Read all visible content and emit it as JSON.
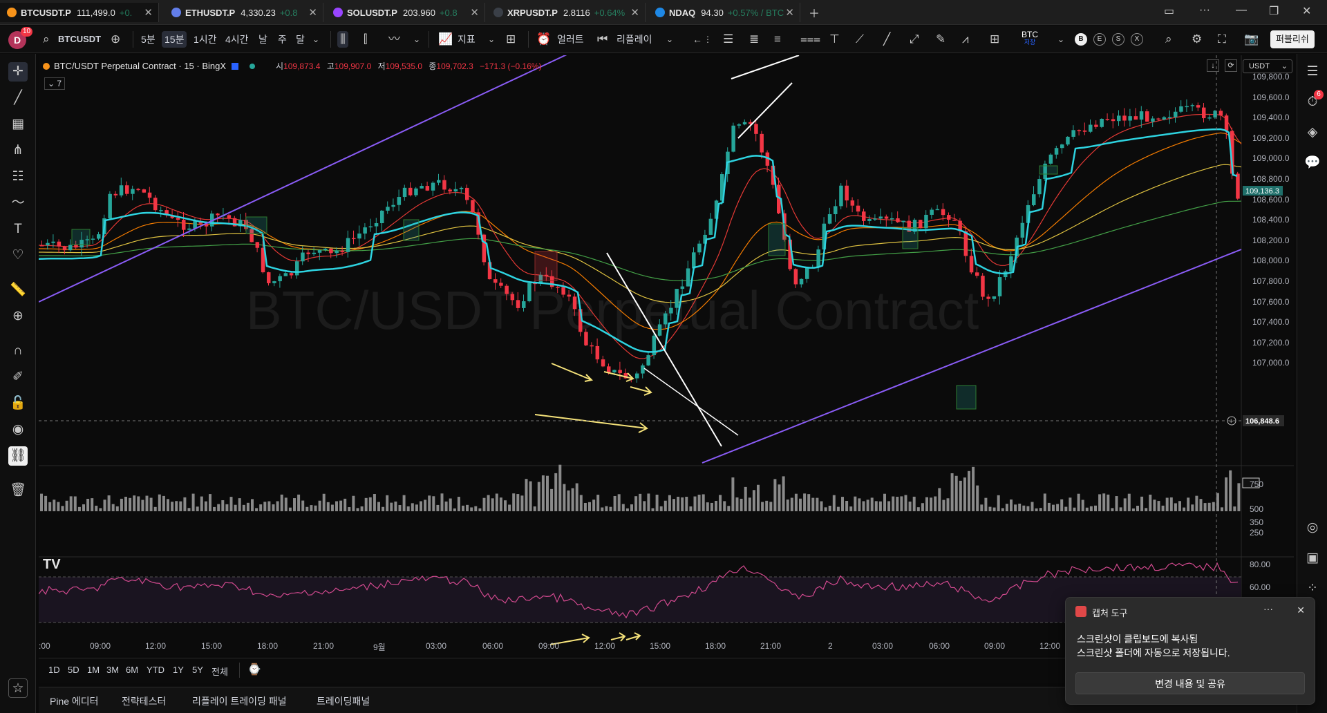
{
  "window_tabs": [
    {
      "symbol": "BTCUSDT.P",
      "price": "111,499.0",
      "change": "+0.",
      "color": "#f7931a"
    },
    {
      "symbol": "ETHUSDT.P",
      "price": "4,330.23",
      "change": "+0.8",
      "color": "#627eea"
    },
    {
      "symbol": "SOLUSDT.P",
      "price": "203.960",
      "change": "+0.8",
      "color": "#9945ff"
    },
    {
      "symbol": "XRPUSDT.P",
      "price": "2.8116",
      "change": "+0.64%",
      "color": "#23292f"
    },
    {
      "symbol": "NDAQ",
      "price": "94.30",
      "change": "+0.57% / BTC",
      "color": "#1e88e5"
    }
  ],
  "toolbar": {
    "avatar_letter": "D",
    "avatar_badge": "10",
    "symbol": "BTCUSDT",
    "intervals": [
      "5분",
      "15분",
      "1시간",
      "4시간",
      "날",
      "주",
      "달"
    ],
    "active_interval": "15분",
    "indicators_label": "지표",
    "alert_label": "얼러트",
    "replay_label": "리플레이",
    "btc_label": "BTC",
    "btc_sub": "저장",
    "publish_label": "퍼블리쉬",
    "chip_labels": [
      "B",
      "E",
      "S",
      "X"
    ]
  },
  "legend": {
    "title": "BTC/USDT Perpetual Contract · 15 · BingX",
    "open_label": "시",
    "open": "109,873.4",
    "high_label": "고",
    "high": "109,907.0",
    "low_label": "저",
    "low": "109,535.0",
    "close_label": "종",
    "close": "109,702.3",
    "change": "−171.3 (−0.16%)",
    "indicator_count": "7"
  },
  "watermark": "BTC/USDT Perpetual Contract",
  "price_axis": {
    "currency": "USDT",
    "labels": [
      "109,800.0",
      "109,600.0",
      "109,400.0",
      "109,200.0",
      "109,000.0",
      "108,800.0",
      "108,600.0",
      "108,400.0",
      "108,200.0",
      "108,000.0",
      "107,800.0",
      "107,600.0",
      "107,400.0",
      "107,200.0",
      "107,000.0"
    ],
    "last_price_tag": "109,136.3",
    "crosshair_price": "106,848.6"
  },
  "volume_axis": {
    "labels": [
      "750",
      "500",
      "350",
      "250"
    ]
  },
  "rsi_axis": {
    "labels": [
      "80.00",
      "60.00"
    ]
  },
  "time_axis": [
    ":00",
    "09:00",
    "12:00",
    "15:00",
    "18:00",
    "21:00",
    "9월",
    "03:00",
    "06:00",
    "09:00",
    "12:00",
    "15:00",
    "18:00",
    "21:00",
    "2",
    "03:00",
    "06:00",
    "09:00",
    "12:00"
  ],
  "range_buttons": [
    "1D",
    "5D",
    "1M",
    "3M",
    "6M",
    "YTD",
    "1Y",
    "5Y",
    "전체"
  ],
  "panel_tabs": [
    "Pine 에디터",
    "전략테스터",
    "리플레이 트레이딩 패널",
    "트레이딩패널"
  ],
  "toast": {
    "title": "캡처 도구",
    "message_line1": "스크린샷이 클립보드에 복사됨",
    "message_line2": "스크린샷 폴더에 자동으로 저장됩니다.",
    "action": "변경 내용 및 공유"
  },
  "sidebar_badge": "6",
  "colors": {
    "up": "#26a69a",
    "down": "#f23645",
    "supertrend_up": "#2ed3e0",
    "supertrend_down": "#d63be8",
    "channel": "#8a5cf6",
    "ma_red": "#e53935",
    "ma_orange": "#f57c00",
    "ma_yellow": "#e0c341",
    "ma_green": "#43a047",
    "rsi": "#d1498e"
  }
}
